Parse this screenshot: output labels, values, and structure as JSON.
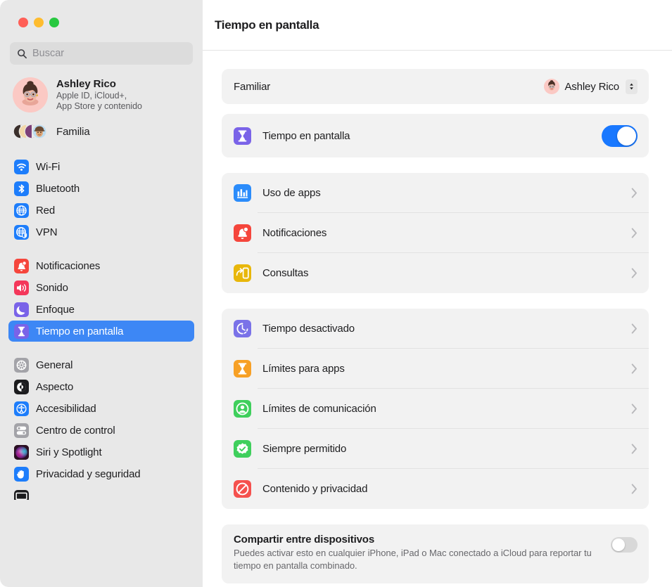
{
  "window": {
    "traffic_lights": [
      "close",
      "minimize",
      "maximize"
    ],
    "title": "Tiempo en pantalla"
  },
  "sidebar": {
    "search": {
      "placeholder": "Buscar",
      "value": "",
      "icon": "search-icon"
    },
    "account": {
      "name": "Ashley Rico",
      "subtitle_line1": "Apple ID, iCloud+,",
      "subtitle_line2": "App Store y contenido",
      "avatar": "memoji-avatar"
    },
    "family": {
      "label": "Familia",
      "icon": "family-avatars-icon"
    },
    "groups": [
      {
        "items": [
          {
            "label": "Wi-Fi",
            "icon": "wifi-icon",
            "color": "#1d7dfb",
            "selected": false
          },
          {
            "label": "Bluetooth",
            "icon": "bluetooth-icon",
            "color": "#1d7dfb",
            "selected": false
          },
          {
            "label": "Red",
            "icon": "network-globe-icon",
            "color": "#1d7dfb",
            "selected": false
          },
          {
            "label": "VPN",
            "icon": "vpn-globe-icon",
            "color": "#1d7dfb",
            "selected": false
          }
        ]
      },
      {
        "items": [
          {
            "label": "Notificaciones",
            "icon": "bell-icon",
            "color": "#f5463c",
            "selected": false
          },
          {
            "label": "Sonido",
            "icon": "speaker-icon",
            "color": "#f4375a",
            "selected": false
          },
          {
            "label": "Enfoque",
            "icon": "moon-icon",
            "color": "#7a63e8",
            "selected": false
          },
          {
            "label": "Tiempo en pantalla",
            "icon": "hourglass-icon",
            "color": "#7a63e8",
            "selected": true
          }
        ]
      },
      {
        "items": [
          {
            "label": "General",
            "icon": "gear-icon",
            "color": "#a3a3a8",
            "selected": false
          },
          {
            "label": "Aspecto",
            "icon": "appearance-icon",
            "color": "#1c1c1e",
            "selected": false
          },
          {
            "label": "Accesibilidad",
            "icon": "accessibility-icon",
            "color": "#1d7dfb",
            "selected": false
          },
          {
            "label": "Centro de control",
            "icon": "control-center-icon",
            "color": "#a3a3a8",
            "selected": false
          },
          {
            "label": "Siri y Spotlight",
            "icon": "siri-icon",
            "color": "#6a2b55",
            "selected": false
          },
          {
            "label": "Privacidad y seguridad",
            "icon": "hand-icon",
            "color": "#1d7dfb",
            "selected": false
          }
        ]
      }
    ],
    "clipped_item": {
      "icon": "display-icon",
      "color": "#1c1c1e"
    }
  },
  "main": {
    "family_member_row": {
      "label": "Familiar",
      "selected_value": "Ashley Rico",
      "avatar": "memoji-avatar",
      "control": "popup-button"
    },
    "screen_time_row": {
      "label": "Tiempo en pantalla",
      "icon": "hourglass-icon",
      "icon_color": "#7a63e8",
      "toggle_on": true
    },
    "group_reports": [
      {
        "label": "Uso de apps",
        "icon": "bar-chart-icon",
        "icon_color": "#2b8cfb"
      },
      {
        "label": "Notificaciones",
        "icon": "bell-icon",
        "icon_color": "#f5463c"
      },
      {
        "label": "Consultas",
        "icon": "pickups-icon",
        "icon_color": "#e8b70b"
      }
    ],
    "group_limits": [
      {
        "label": "Tiempo desactivado",
        "icon": "downtime-clock-icon",
        "icon_color": "#7a72e8"
      },
      {
        "label": "Límites para apps",
        "icon": "hourglass-icon",
        "icon_color": "#f7a025"
      },
      {
        "label": "Límites de comunicación",
        "icon": "person-circle-icon",
        "icon_color": "#3fcf5c"
      },
      {
        "label": "Siempre permitido",
        "icon": "checkmark-seal-icon",
        "icon_color": "#3fcf5c"
      },
      {
        "label": "Contenido y privacidad",
        "icon": "no-entry-icon",
        "icon_color": "#f5514e"
      }
    ],
    "share_across_devices": {
      "title": "Compartir entre dispositivos",
      "description": "Puedes activar esto en cualquier iPhone, iPad o Mac conectado a iCloud para reportar tu tiempo en pantalla combinado.",
      "toggle_on": false
    }
  },
  "colors": {
    "accent_blue": "#3d87f5",
    "toggle_on": "#1978ff",
    "sidebar_bg": "#e8e8e8",
    "card_bg": "#f2f2f2",
    "text_primary": "#1d1d1f",
    "text_secondary": "#68686c"
  }
}
